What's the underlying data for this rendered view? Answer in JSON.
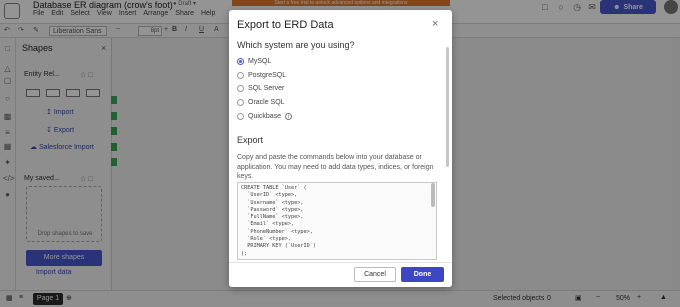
{
  "app": {
    "doc_title": "Database ER diagram (crow's foot)",
    "draft_label": "● Draft ▾",
    "menu": [
      "File",
      "Edit",
      "Select",
      "View",
      "Insert",
      "Arrange",
      "Share",
      "Help"
    ],
    "banner_text": "Start a free trial to unlock advanced options and integrations",
    "share_label": "Share",
    "share_icon": "person-plus-icon"
  },
  "toolbar": {
    "font": "Liberation Sans",
    "font_size": "8pt"
  },
  "panel": {
    "title": "Shapes",
    "section1_title": "Entity Rel...",
    "import_label": "Import",
    "export_label": "Export",
    "salesforce_label": "Salesforce Import",
    "section2_title": "My saved...",
    "drop_label": "Drop shapes to save",
    "more_shapes_label": "More shapes",
    "import_data_label": "Import data"
  },
  "bottombar": {
    "page_label": "Page 1",
    "selected_label": "Selected objects",
    "selected_count": "0",
    "zoom": "50%"
  },
  "modal": {
    "title": "Export to ERD Data",
    "question": "Which system are you using?",
    "options": [
      {
        "label": "MySQL",
        "checked": true
      },
      {
        "label": "PostgreSQL",
        "checked": false
      },
      {
        "label": "SQL Server",
        "checked": false
      },
      {
        "label": "Oracle SQL",
        "checked": false
      },
      {
        "label": "Quickbase",
        "checked": false
      }
    ],
    "export_heading": "Export",
    "export_description": "Copy and paste the commands below into your database or application. You may need to add data types, indices, or foreign keys.",
    "code_lines": [
      "CREATE TABLE `User` (",
      "  `UserID` <type>,",
      "  `Username` <type>,",
      "  `Password` <type>,",
      "  `FullName` <type>,",
      "  `Email` <type>,",
      "  `PhoneNumber` <type>,",
      "  `Role` <type>,",
      "  PRIMARY KEY (`UserID`)",
      ");"
    ],
    "cancel_label": "Cancel",
    "done_label": "Done"
  },
  "colors": {
    "accent": "#4b58cf",
    "done": "#3f46c4",
    "banner": "#e07a32",
    "canvas_marker": "#3aa655"
  }
}
